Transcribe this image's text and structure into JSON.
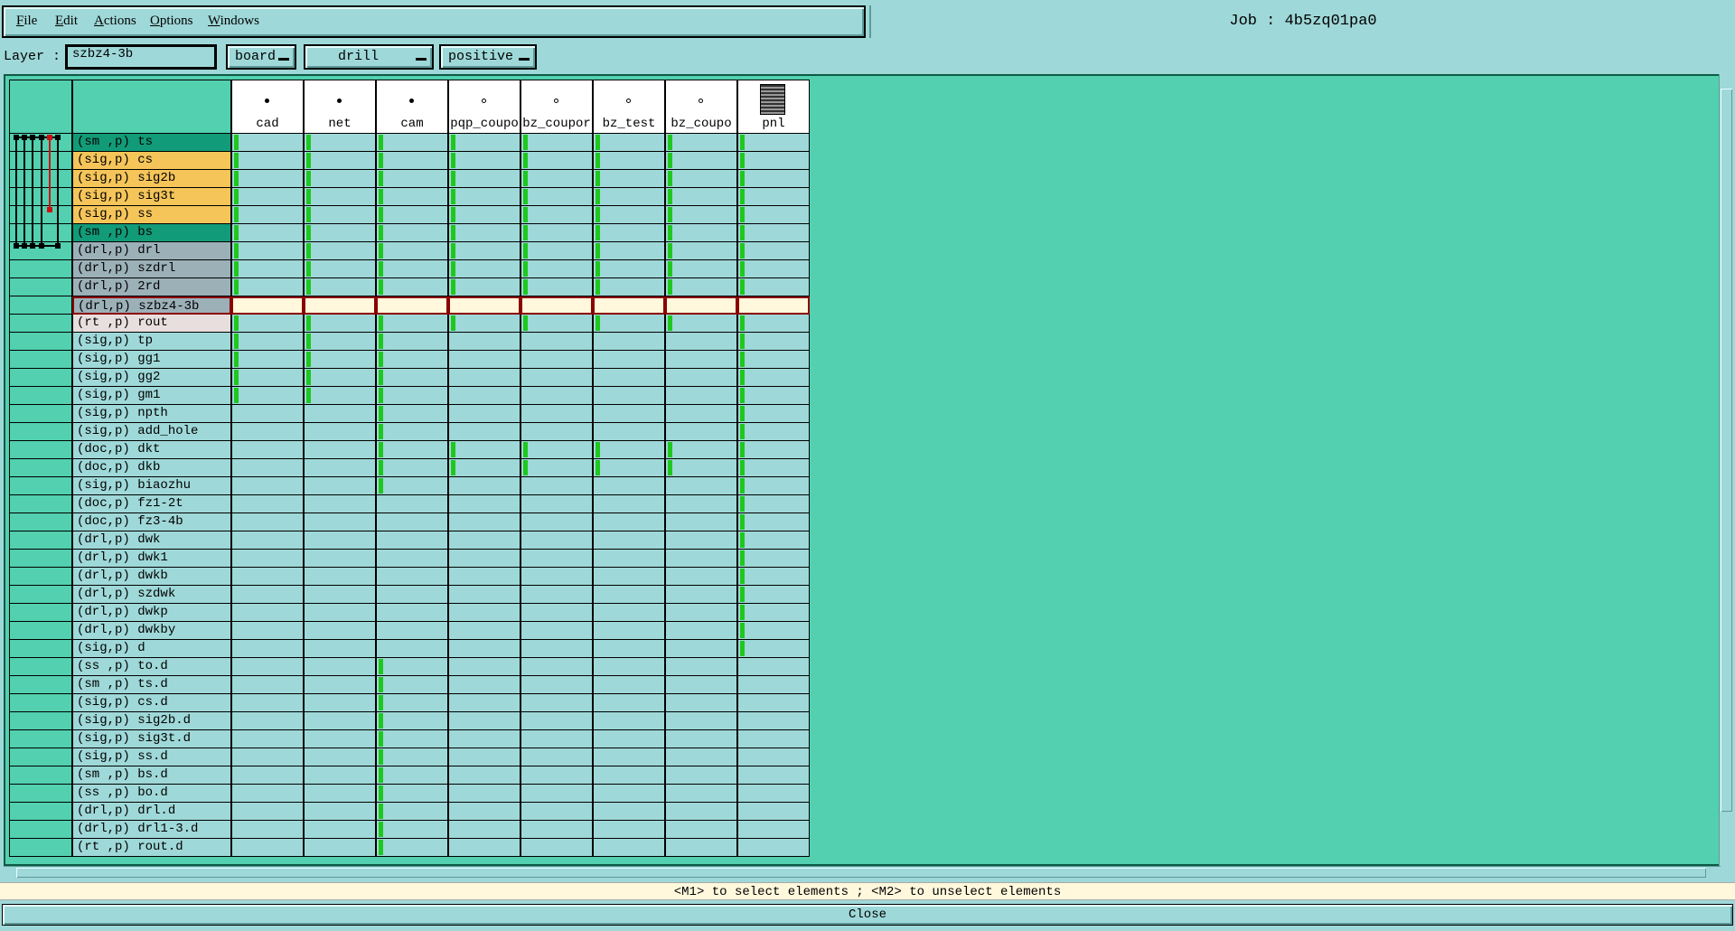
{
  "menu": {
    "items": [
      {
        "first": "F",
        "rest": "ile"
      },
      {
        "first": "E",
        "rest": "dit"
      },
      {
        "first": "A",
        "rest": "ctions"
      },
      {
        "first": "O",
        "rest": "ptions"
      },
      {
        "first": "W",
        "rest": "indows"
      }
    ]
  },
  "job": {
    "title": "Job : 4b5zq01pa0"
  },
  "layerbar": {
    "label": "Layer :",
    "value": "szbz4-3b",
    "context": "board",
    "type": "drill",
    "polarity": "positive"
  },
  "columns": [
    {
      "label": "cad",
      "icon": "dot-filled-icon"
    },
    {
      "label": "net",
      "icon": "dot-filled-icon"
    },
    {
      "label": "cam",
      "icon": "dot-filled-icon"
    },
    {
      "label": "pqp_coupo",
      "icon": "dot-icon"
    },
    {
      "label": "bz_coupor",
      "icon": "dot-icon"
    },
    {
      "label": "bz_test",
      "icon": "dot-icon"
    },
    {
      "label": "bz_coupo",
      "icon": "dot-icon"
    },
    {
      "label": "pnl",
      "icon": "panel-icon"
    }
  ],
  "colors": {
    "sm": "#129b78",
    "sig_outer": "#f5c55a",
    "drl": "#9cb0b8",
    "rout": "#e8dede",
    "default": "#9fd8d8",
    "mark": "#1ec81e",
    "active_border": "#8b0000"
  },
  "rows": [
    {
      "name": "(sm ,p) ts",
      "color": "sm",
      "marks": [
        1,
        1,
        1,
        1,
        1,
        1,
        1,
        1
      ]
    },
    {
      "name": "(sig,p) cs",
      "color": "sig_outer",
      "marks": [
        1,
        1,
        1,
        1,
        1,
        1,
        1,
        1
      ]
    },
    {
      "name": "(sig,p) sig2b",
      "color": "sig_outer",
      "marks": [
        1,
        1,
        1,
        1,
        1,
        1,
        1,
        1
      ]
    },
    {
      "name": "(sig,p) sig3t",
      "color": "sig_outer",
      "marks": [
        1,
        1,
        1,
        1,
        1,
        1,
        1,
        1
      ]
    },
    {
      "name": "(sig,p) ss",
      "color": "sig_outer",
      "marks": [
        1,
        1,
        1,
        1,
        1,
        1,
        1,
        1
      ]
    },
    {
      "name": "(sm ,p) bs",
      "color": "sm",
      "marks": [
        1,
        1,
        1,
        1,
        1,
        1,
        1,
        1
      ]
    },
    {
      "name": "(drl,p) drl",
      "color": "drl",
      "marks": [
        1,
        1,
        1,
        1,
        1,
        1,
        1,
        1
      ]
    },
    {
      "name": "(drl,p) szdrl",
      "color": "drl",
      "marks": [
        1,
        1,
        1,
        1,
        1,
        1,
        1,
        1
      ]
    },
    {
      "name": "(drl,p) 2rd",
      "color": "drl",
      "marks": [
        1,
        1,
        1,
        1,
        1,
        1,
        1,
        1
      ]
    },
    {
      "name": "(drl,p) szbz4-3b",
      "color": "drl",
      "marks": [
        0,
        0,
        0,
        0,
        0,
        0,
        0,
        0
      ],
      "active": true
    },
    {
      "name": "(rt ,p) rout",
      "color": "rout",
      "marks": [
        1,
        1,
        1,
        1,
        1,
        1,
        1,
        1
      ]
    },
    {
      "name": "(sig,p) tp",
      "color": "default",
      "marks": [
        1,
        1,
        1,
        0,
        0,
        0,
        0,
        1
      ]
    },
    {
      "name": "(sig,p) gg1",
      "color": "default",
      "marks": [
        1,
        1,
        1,
        0,
        0,
        0,
        0,
        1
      ]
    },
    {
      "name": "(sig,p) gg2",
      "color": "default",
      "marks": [
        1,
        1,
        1,
        0,
        0,
        0,
        0,
        1
      ]
    },
    {
      "name": "(sig,p) gm1",
      "color": "default",
      "marks": [
        1,
        1,
        1,
        0,
        0,
        0,
        0,
        1
      ]
    },
    {
      "name": "(sig,p) npth",
      "color": "default",
      "marks": [
        0,
        0,
        1,
        0,
        0,
        0,
        0,
        1
      ]
    },
    {
      "name": "(sig,p) add_hole",
      "color": "default",
      "marks": [
        0,
        0,
        1,
        0,
        0,
        0,
        0,
        1
      ]
    },
    {
      "name": "(doc,p) dkt",
      "color": "default",
      "marks": [
        0,
        0,
        1,
        1,
        1,
        1,
        1,
        1
      ]
    },
    {
      "name": "(doc,p) dkb",
      "color": "default",
      "marks": [
        0,
        0,
        1,
        1,
        1,
        1,
        1,
        1
      ]
    },
    {
      "name": "(sig,p) biaozhu",
      "color": "default",
      "marks": [
        0,
        0,
        1,
        0,
        0,
        0,
        0,
        1
      ]
    },
    {
      "name": "(doc,p) fz1-2t",
      "color": "default",
      "marks": [
        0,
        0,
        0,
        0,
        0,
        0,
        0,
        1
      ]
    },
    {
      "name": "(doc,p) fz3-4b",
      "color": "default",
      "marks": [
        0,
        0,
        0,
        0,
        0,
        0,
        0,
        1
      ]
    },
    {
      "name": "(drl,p) dwk",
      "color": "default",
      "marks": [
        0,
        0,
        0,
        0,
        0,
        0,
        0,
        1
      ]
    },
    {
      "name": "(drl,p) dwk1",
      "color": "default",
      "marks": [
        0,
        0,
        0,
        0,
        0,
        0,
        0,
        1
      ]
    },
    {
      "name": "(drl,p) dwkb",
      "color": "default",
      "marks": [
        0,
        0,
        0,
        0,
        0,
        0,
        0,
        1
      ]
    },
    {
      "name": "(drl,p) szdwk",
      "color": "default",
      "marks": [
        0,
        0,
        0,
        0,
        0,
        0,
        0,
        1
      ]
    },
    {
      "name": "(drl,p) dwkp",
      "color": "default",
      "marks": [
        0,
        0,
        0,
        0,
        0,
        0,
        0,
        1
      ]
    },
    {
      "name": "(drl,p) dwkby",
      "color": "default",
      "marks": [
        0,
        0,
        0,
        0,
        0,
        0,
        0,
        1
      ]
    },
    {
      "name": "(sig,p) d",
      "color": "default",
      "marks": [
        0,
        0,
        0,
        0,
        0,
        0,
        0,
        1
      ]
    },
    {
      "name": "(ss ,p) to.d",
      "color": "default",
      "marks": [
        0,
        0,
        1,
        0,
        0,
        0,
        0,
        0
      ]
    },
    {
      "name": "(sm ,p) ts.d",
      "color": "default",
      "marks": [
        0,
        0,
        1,
        0,
        0,
        0,
        0,
        0
      ]
    },
    {
      "name": "(sig,p) cs.d",
      "color": "default",
      "marks": [
        0,
        0,
        1,
        0,
        0,
        0,
        0,
        0
      ]
    },
    {
      "name": "(sig,p) sig2b.d",
      "color": "default",
      "marks": [
        0,
        0,
        1,
        0,
        0,
        0,
        0,
        0
      ]
    },
    {
      "name": "(sig,p) sig3t.d",
      "color": "default",
      "marks": [
        0,
        0,
        1,
        0,
        0,
        0,
        0,
        0
      ]
    },
    {
      "name": "(sig,p) ss.d",
      "color": "default",
      "marks": [
        0,
        0,
        1,
        0,
        0,
        0,
        0,
        0
      ]
    },
    {
      "name": "(sm ,p) bs.d",
      "color": "default",
      "marks": [
        0,
        0,
        1,
        0,
        0,
        0,
        0,
        0
      ]
    },
    {
      "name": "(ss ,p) bo.d",
      "color": "default",
      "marks": [
        0,
        0,
        1,
        0,
        0,
        0,
        0,
        0
      ]
    },
    {
      "name": "(drl,p) drl.d",
      "color": "default",
      "marks": [
        0,
        0,
        1,
        0,
        0,
        0,
        0,
        0
      ]
    },
    {
      "name": "(drl,p) drl1-3.d",
      "color": "default",
      "marks": [
        0,
        0,
        1,
        0,
        0,
        0,
        0,
        0
      ]
    },
    {
      "name": "(rt ,p) rout.d",
      "color": "default",
      "marks": [
        0,
        0,
        1,
        0,
        0,
        0,
        0,
        0
      ]
    }
  ],
  "status": {
    "hint": "<M1> to select elements ; <M2> to unselect elements"
  },
  "close": {
    "label": "Close"
  }
}
